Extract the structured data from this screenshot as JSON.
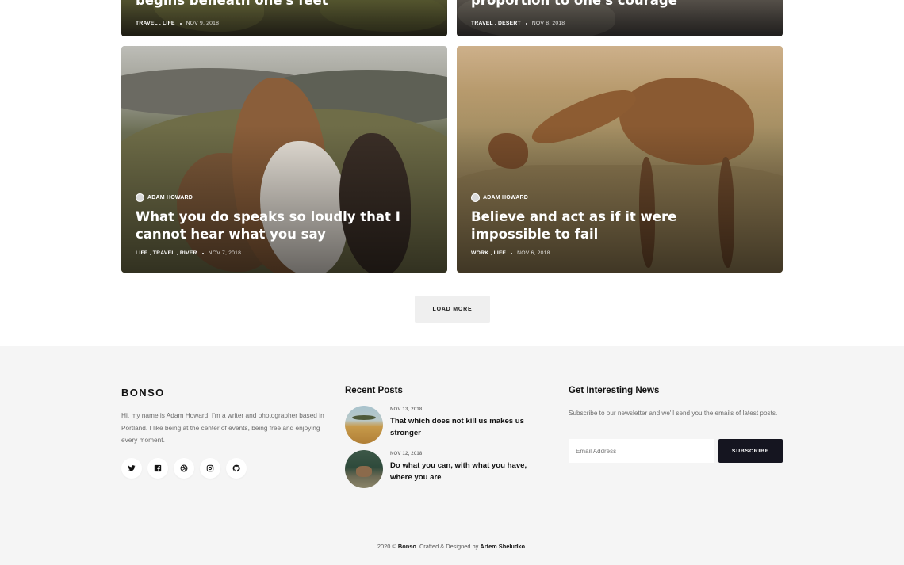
{
  "cards": [
    {
      "title": "begins beneath one's feet",
      "tags": [
        "TRAVEL",
        "LIFE"
      ],
      "tags_text": "TRAVEL , LIFE",
      "date": "NOV 9, 2018"
    },
    {
      "title": "proportion to one's courage",
      "tags": [
        "TRAVEL",
        "DESERT"
      ],
      "tags_text": "TRAVEL , DESERT",
      "date": "NOV 8, 2018"
    },
    {
      "author": "ADAM HOWARD",
      "title_line1": "What you do speaks so loudly that I",
      "title_line2": "cannot hear what you say",
      "tags": [
        "LIFE",
        "TRAVEL",
        "RIVER"
      ],
      "tags_text": "LIFE , TRAVEL , RIVER",
      "date": "NOV 7, 2018"
    },
    {
      "author": "ADAM HOWARD",
      "title_line1": "Believe and act as if it were",
      "title_line2": "impossible to fail",
      "tags": [
        "WORK",
        "LIFE"
      ],
      "tags_text": "WORK , LIFE",
      "date": "NOV 6, 2018"
    }
  ],
  "load_more": "LOAD MORE",
  "footer": {
    "logo": "BONSO",
    "about": "Hi, my name is Adam Howard. I'm a writer and photographer based in Portland. I like being at the center of events, being free and enjoying every moment.",
    "socials": [
      "twitter-icon",
      "facebook-icon",
      "dribbble-icon",
      "instagram-icon",
      "github-icon"
    ],
    "recent_heading": "Recent Posts",
    "recent_posts": [
      {
        "date": "NOV 13, 2018",
        "title": "That which does not kill us makes us stronger"
      },
      {
        "date": "NOV 12, 2018",
        "title": "Do what you can, with what you have, where you are"
      }
    ],
    "news_heading": "Get Interesting News",
    "news_text": "Subscribe to our newsletter and we'll send you the emails of latest posts.",
    "email_placeholder": "Email Address",
    "subscribe_label": "SUBSCRIBE",
    "copyright": {
      "prefix": "2020 © ",
      "brand": "Bonso",
      "middle": ". Crafted & Designed by ",
      "designer": "Artem Sheludko",
      "suffix": "."
    }
  }
}
